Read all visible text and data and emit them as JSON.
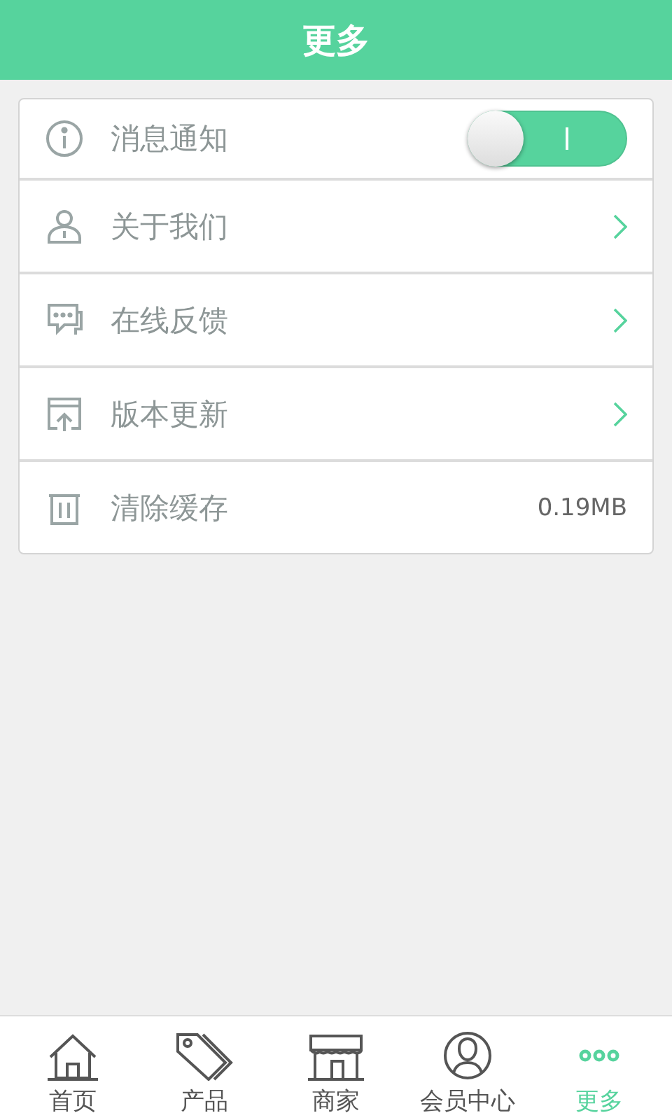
{
  "header": {
    "title": "更多"
  },
  "settings": [
    {
      "kind": "toggle",
      "label": "消息通知",
      "on": true
    },
    {
      "kind": "link",
      "label": "关于我们"
    },
    {
      "kind": "link",
      "label": "在线反馈"
    },
    {
      "kind": "link",
      "label": "版本更新"
    },
    {
      "kind": "value",
      "label": "清除缓存",
      "value": "0.19MB"
    }
  ],
  "tab_bar": [
    {
      "label": "首页",
      "selected": false
    },
    {
      "label": "产品",
      "selected": false
    },
    {
      "label": "商家",
      "selected": false
    },
    {
      "label": "会员中心",
      "selected": false
    },
    {
      "label": "更多",
      "selected": true
    }
  ]
}
